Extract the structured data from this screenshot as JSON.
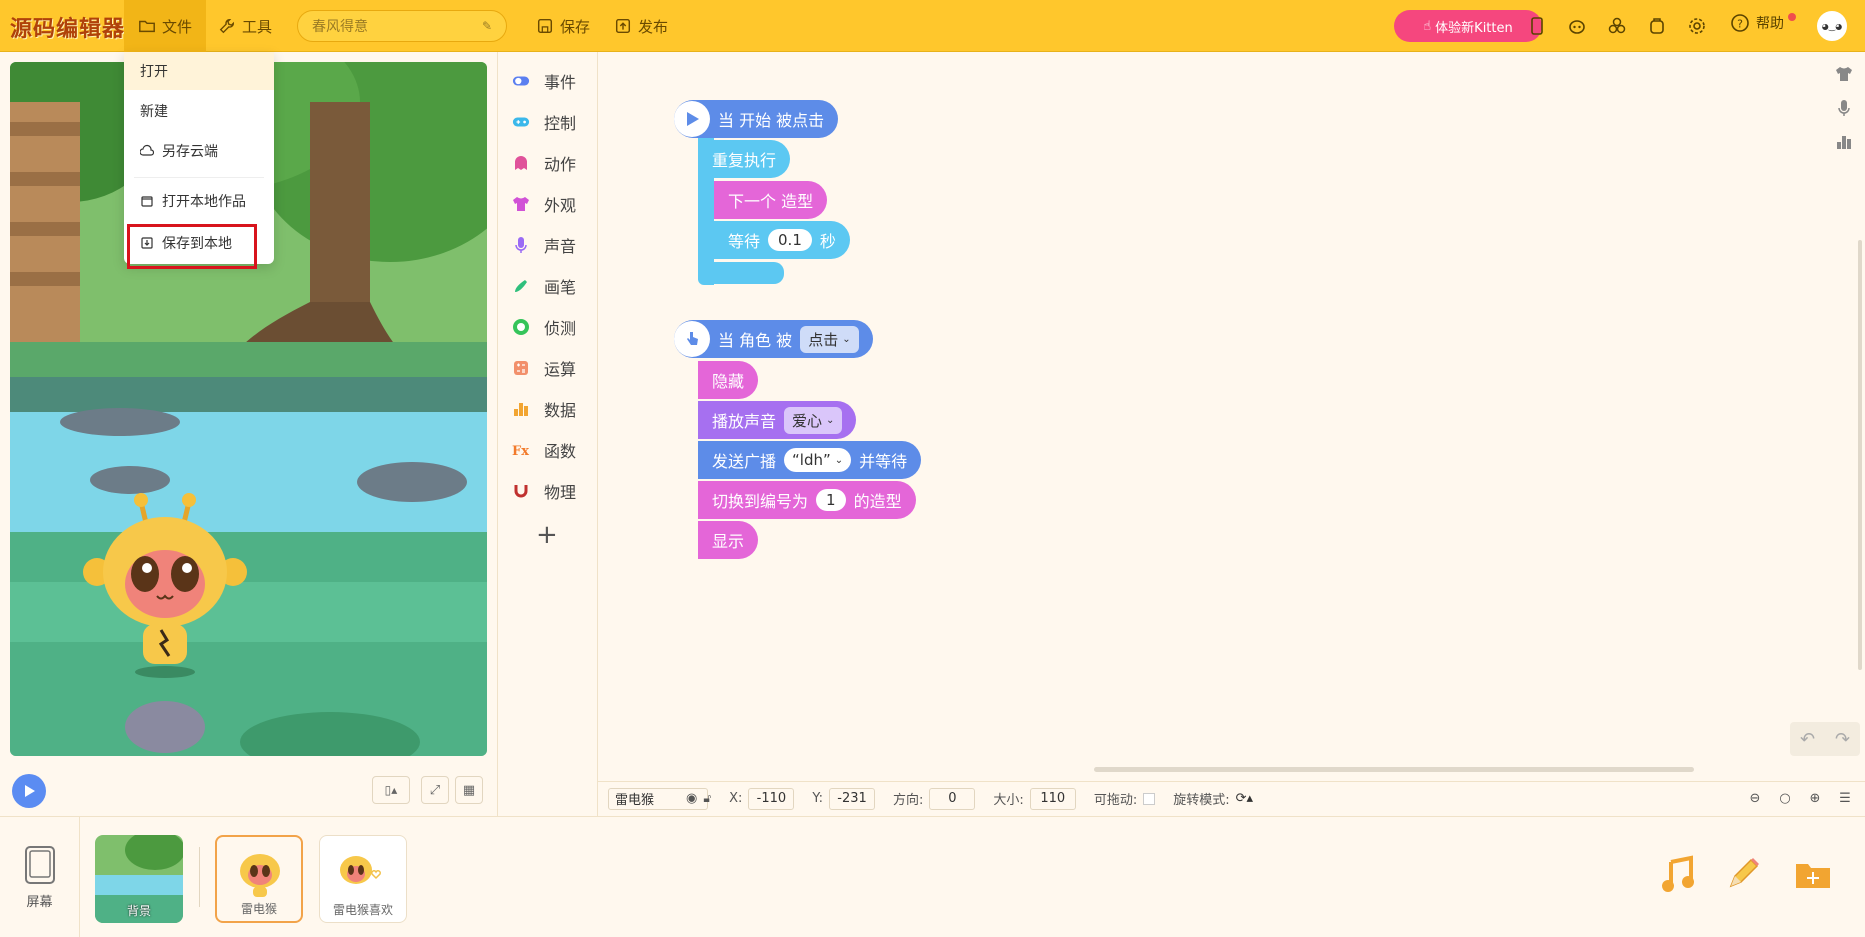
{
  "app": {
    "logo": "源码编辑器",
    "menu_file": "文件",
    "menu_tools": "工具",
    "project_title": "春风得意",
    "save": "保存",
    "publish": "发布",
    "kitten_btn": "体验新Kitten",
    "help": "帮助"
  },
  "file_menu": {
    "items": [
      "打开",
      "新建",
      "另存云端",
      "打开本地作品",
      "保存到本地"
    ]
  },
  "categories": [
    "事件",
    "控制",
    "动作",
    "外观",
    "声音",
    "画笔",
    "侦测",
    "运算",
    "数据",
    "函数",
    "物理"
  ],
  "category_colors": [
    "#5b7ff0",
    "#3bb8ea",
    "#e0529a",
    "#d152d6",
    "#9a6bf5",
    "#2fbf7c",
    "#35c45a",
    "#f2906b",
    "#f2a531",
    "#f27a2a",
    "#c0312f"
  ],
  "script1": {
    "hat": "当 开始 被点击",
    "repeat": "重复执行",
    "next_costume": "下一个 造型",
    "wait": "等待",
    "wait_value": "0.1",
    "wait_unit": "秒"
  },
  "script2": {
    "hat_prefix": "当 角色 被",
    "hat_option": "点击",
    "hide": "隐藏",
    "play_sound": "播放声音",
    "sound_option": "爱心",
    "broadcast": "发送广播",
    "broadcast_option": "“ldh”",
    "broadcast_suffix": "并等待",
    "switch_prefix": "切换到编号为",
    "switch_value": "1",
    "switch_suffix": "的造型",
    "show": "显示"
  },
  "props": {
    "sprite_name": "雷电猴",
    "x_label": "X:",
    "x_value": "-110",
    "y_label": "Y:",
    "y_value": "-231",
    "dir_label": "方向:",
    "dir_value": "0",
    "size_label": "大小:",
    "size_value": "110",
    "drag_label": "可拖动:",
    "rotate_label": "旋转模式:"
  },
  "bottom": {
    "screen": "屏幕",
    "thumbs": [
      "背景",
      "雷电猴",
      "雷电猴喜欢"
    ]
  }
}
